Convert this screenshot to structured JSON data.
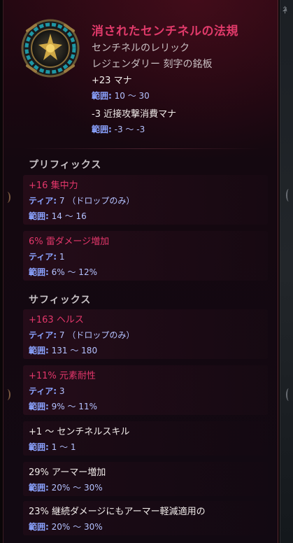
{
  "item": {
    "name": "消されたセンチネルの法規",
    "type_line": "センチネルのレリック",
    "rarity_line": "レジェンダリー 刻字の銘板",
    "implicits": [
      {
        "stat": "+23 マナ",
        "range_label": "範囲:",
        "range_value": "10 〜 30"
      },
      {
        "stat": "-3 近接攻撃消費マナ",
        "range_label": "範囲:",
        "range_value": "-3 〜 -3"
      }
    ]
  },
  "sections": {
    "prefix_title": "プリフィックス",
    "suffix_title": "サフィックス"
  },
  "prefixes": [
    {
      "stat": "+16 集中力",
      "tier_label": "ティア:",
      "tier_value": "7 （ドロップのみ）",
      "range_label": "範囲:",
      "range_value": "14 〜 16"
    },
    {
      "stat": "6% 雷ダメージ増加",
      "tier_label": "ティア:",
      "tier_value": "1",
      "range_label": "範囲:",
      "range_value": "6% 〜 12%"
    }
  ],
  "suffixes": [
    {
      "stat": "+163 ヘルス",
      "tier_label": "ティア:",
      "tier_value": "7 （ドロップのみ）",
      "range_label": "範囲:",
      "range_value": "131 〜 180"
    },
    {
      "stat": "+11% 元素耐性",
      "tier_label": "ティア:",
      "tier_value": "3",
      "range_label": "範囲:",
      "range_value": "9% 〜 11%"
    }
  ],
  "uniques": [
    {
      "stat": "+1 〜 センチネルスキル",
      "range_label": "範囲:",
      "range_value": "1 〜 1"
    },
    {
      "stat": "29% アーマー増加",
      "range_label": "範囲:",
      "range_value": "20% 〜 30%"
    },
    {
      "stat": "23% 継続ダメージにもアーマー軽減適用の",
      "range_label": "範囲:",
      "range_value": "20% 〜 30%"
    }
  ],
  "side_strip_glyph": "衤",
  "colors": {
    "name": "#e03a6a",
    "affix_pink": "#e4376b",
    "range_blue": "#8aa2ff",
    "panel_bg": "#140810"
  },
  "icons": {
    "item": "sentinel-relic-emblem-icon"
  }
}
